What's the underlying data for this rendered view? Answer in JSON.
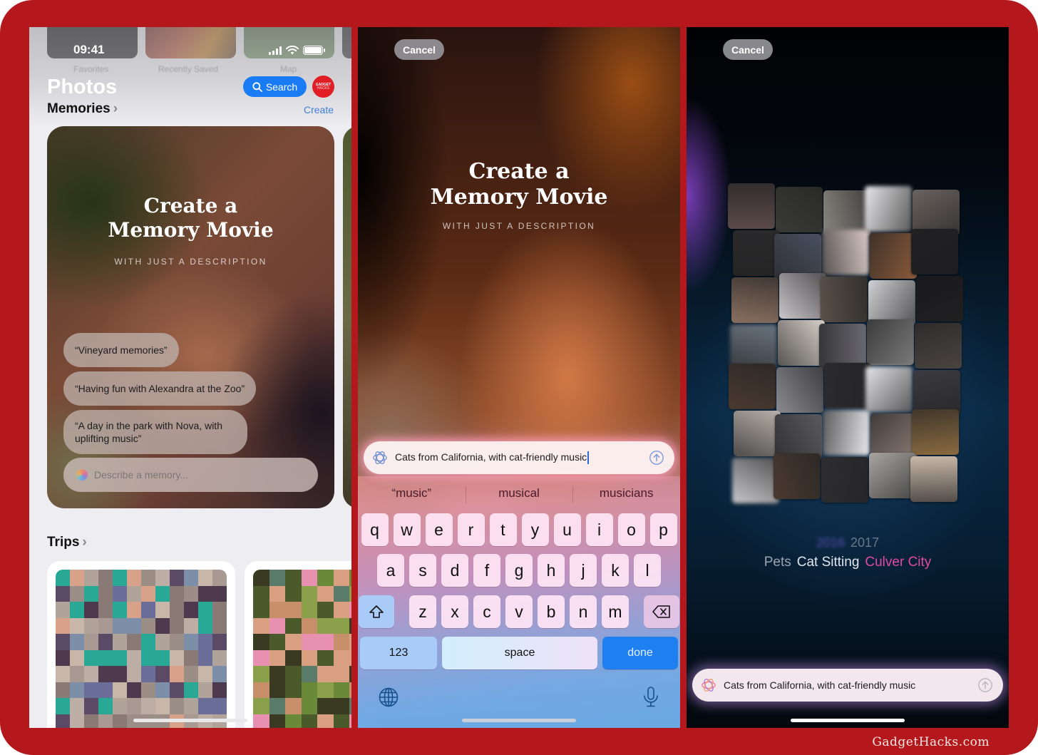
{
  "watermark": "GadgetHacks.com",
  "panels": {
    "library": {
      "status_bar": {
        "time": "09:41"
      },
      "albums": [
        {
          "label": "Favorites",
          "color": "#1c1c1e"
        },
        {
          "label": "Recently Saved",
          "color": "#7a3a2a"
        },
        {
          "label": "Map",
          "color": "#5a7a4a"
        }
      ],
      "title": "Photos",
      "search_label": "Search",
      "avatar": {
        "line1": "GADGET",
        "line2": "HACKS"
      },
      "memories_heading": "Memories",
      "create_label": "Create",
      "card": {
        "title_line1": "Create a",
        "title_line2": "Memory Movie",
        "subtitle": "WITH JUST A DESCRIPTION",
        "suggestions": [
          "“Vineyard memories”",
          "“Having fun with Alexandra at the Zoo”",
          "“A day in the park with Nova, with uplifting music”"
        ],
        "input_placeholder": "Describe a memory..."
      },
      "trips_heading": "Trips"
    },
    "compose": {
      "cancel_label": "Cancel",
      "title_line1": "Create a",
      "title_line2": "Memory Movie",
      "subtitle": "WITH JUST A DESCRIPTION",
      "prompt_value": "Cats from California, with cat-friendly music",
      "predictions": [
        "“music”",
        "musical",
        "musicians"
      ],
      "keyboard": {
        "row1": [
          "q",
          "w",
          "e",
          "r",
          "t",
          "y",
          "u",
          "i",
          "o",
          "p"
        ],
        "row2": [
          "a",
          "s",
          "d",
          "f",
          "g",
          "h",
          "j",
          "k",
          "l"
        ],
        "row3": [
          "z",
          "x",
          "c",
          "v",
          "b",
          "n",
          "m"
        ],
        "numbers_label": "123",
        "space_label": "space",
        "done_label": "done"
      }
    },
    "generating": {
      "cancel_label": "Cancel",
      "year_blurred": "2016",
      "year": "2017",
      "tags": [
        "Pets",
        "Cat Sitting",
        "Culver City"
      ],
      "prompt_value": "Cats from California, with cat-friendly music"
    }
  },
  "colors": {
    "frame": "#b5181c",
    "accent_blue": "#1a7cf5",
    "tag_pink": "#e04aa0"
  }
}
